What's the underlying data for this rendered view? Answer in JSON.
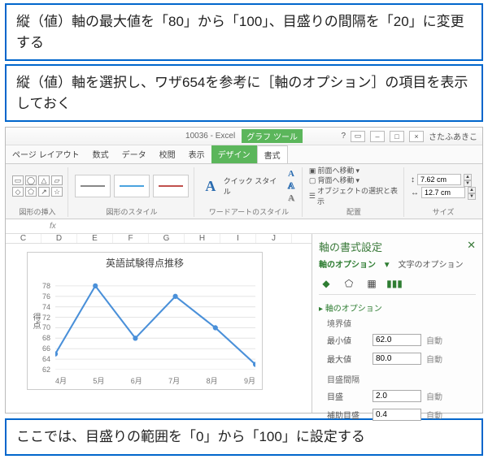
{
  "callouts": {
    "c1": "縦（値）軸の最大値を「80」から「100」、目盛りの間隔を「20」に変更する",
    "c2": "縦（値）軸を選択し、ワザ654を参考に［軸のオプション］の項目を表示しておく",
    "c3": "ここでは、目盛りの範囲を「0」から「100」に設定する"
  },
  "window": {
    "title": "10036 - Excel",
    "chart_tools": "グラフ ツール",
    "username": "さたふあきこ"
  },
  "tabs": [
    "ページ レイアウト",
    "数式",
    "データ",
    "校閲",
    "表示",
    "デザイン",
    "書式"
  ],
  "ribbon": {
    "group_shapes": "図形の挿入",
    "group_shape_styles": "図形のスタイル",
    "group_wordart": "ワードアートのスタイル",
    "quick_style": "クイック スタイル",
    "group_arrange": "配置",
    "arrange_items": [
      "前面へ移動",
      "背面へ移動",
      "オブジェクトの選択と表示"
    ],
    "group_size": "サイズ",
    "size_h": "7.62 cm",
    "size_w": "12.7 cm"
  },
  "sheet": {
    "cols": [
      "C",
      "D",
      "E",
      "F",
      "G",
      "H",
      "I",
      "J"
    ]
  },
  "chart_data": {
    "type": "line",
    "title": "英語試験得点推移",
    "ylabel": "得点",
    "categories": [
      "4月",
      "5月",
      "6月",
      "7月",
      "8月",
      "9月"
    ],
    "values": [
      65,
      78,
      68,
      76,
      70,
      63
    ],
    "yticks": [
      62,
      64,
      66,
      68,
      70,
      72,
      74,
      76,
      78
    ],
    "ylim": [
      62,
      80
    ]
  },
  "pane": {
    "title": "軸の書式設定",
    "tab_axis": "軸のオプション",
    "tab_text": "文字のオプション",
    "section": "軸のオプション",
    "bounds": "境界値",
    "min_label": "最小値",
    "min_value": "62.0",
    "max_label": "最大値",
    "max_value": "80.0",
    "units": "目盛間隔",
    "major_label": "目盛",
    "major_value": "2.0",
    "minor_label": "補助目盛",
    "minor_value": "0.4",
    "auto": "自動"
  }
}
